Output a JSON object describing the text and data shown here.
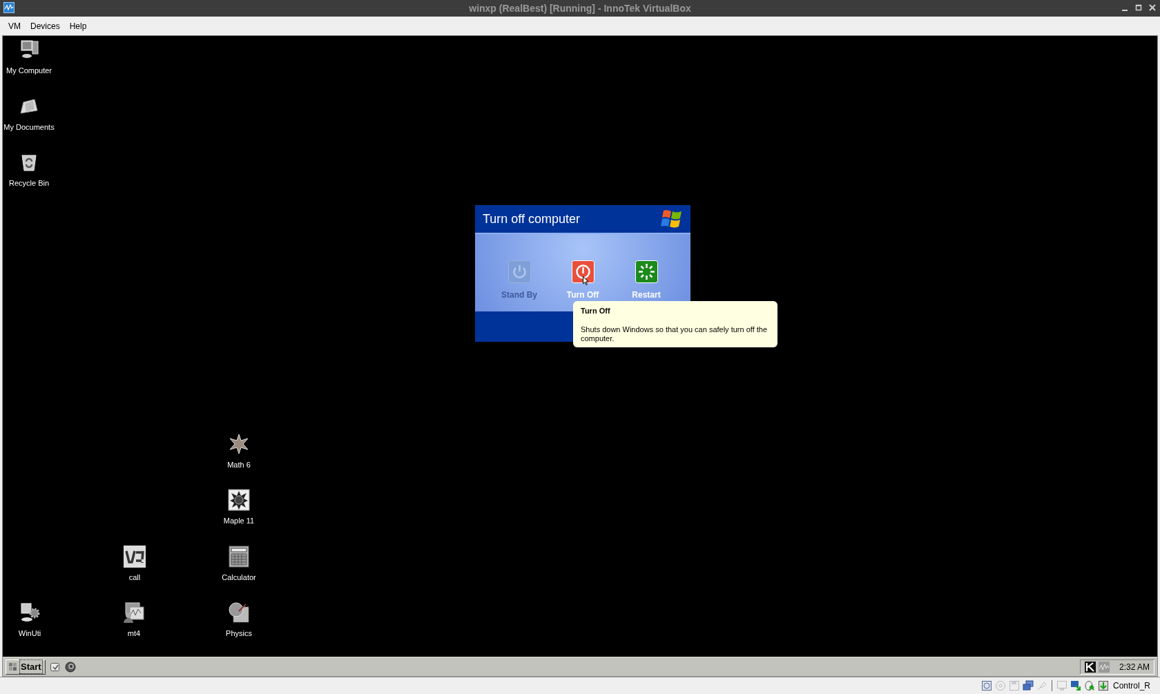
{
  "window": {
    "title": "winxp (RealBest) [Running] - InnoTek VirtualBox"
  },
  "menu": [
    {
      "label": "VM"
    },
    {
      "label": "Devices"
    },
    {
      "label": "Help"
    }
  ],
  "desktop_icons": [
    {
      "label": "My Computer",
      "kind": "computer"
    },
    {
      "label": "My Documents",
      "kind": "folder"
    },
    {
      "label": "Recycle Bin",
      "kind": "bin"
    },
    {
      "label": "Math 6",
      "kind": "star"
    },
    {
      "label": "Maple 11",
      "kind": "maple"
    },
    {
      "label": "call",
      "kind": "vs"
    },
    {
      "label": "Calculator",
      "kind": "calculator"
    },
    {
      "label": "WinUti",
      "kind": "computer-gear"
    },
    {
      "label": "mt4",
      "kind": "chart-person"
    },
    {
      "label": "Physics",
      "kind": "physics"
    }
  ],
  "dialog": {
    "title": "Turn off computer",
    "buttons": [
      {
        "label": "Stand By",
        "kind": "standby",
        "disabled": true
      },
      {
        "label": "Turn Off",
        "kind": "turnoff",
        "disabled": false
      },
      {
        "label": "Restart",
        "kind": "restart",
        "disabled": false
      }
    ]
  },
  "tooltip": {
    "title": "Turn Off",
    "text": "Shuts down Windows so that you can safely turn off the computer."
  },
  "taskbar": {
    "start": "Start",
    "clock": "2:32 AM"
  },
  "status_bar": {
    "host_key": "Control_R"
  }
}
